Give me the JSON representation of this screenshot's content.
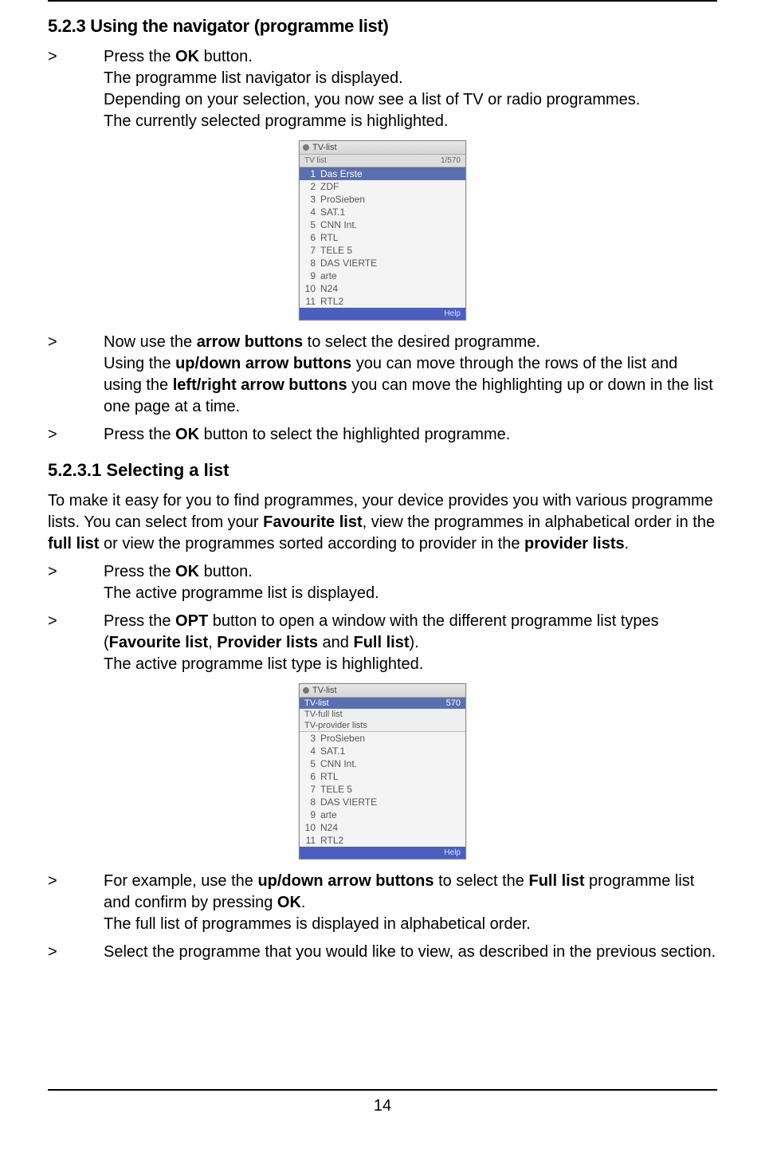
{
  "page_number": "14",
  "section_523": {
    "heading": "5.2.3 Using the navigator (programme list)",
    "step1": {
      "prefix": "Press the ",
      "bold1": "OK",
      "suffix": " button."
    },
    "para1": "The programme list navigator is displayed.",
    "para2": "Depending on your selection, you now see a list of TV or radio programmes.",
    "para3": "The currently selected programme is highlighted.",
    "step2": {
      "prefix": "Now use the ",
      "bold1": "arrow buttons",
      "mid1": " to select the desired programme."
    },
    "para4": {
      "p1": "Using the ",
      "b1": "up/down arrow buttons",
      "p2": " you can move through the rows of the list and using the ",
      "b2": "left/right arrow buttons",
      "p3": " you can move the highlighting up or down in the list one page at a time."
    },
    "step3": {
      "prefix": "Press the ",
      "bold1": "OK",
      "suffix": " button to select the highlighted programme."
    }
  },
  "section_5231": {
    "heading": "5.2.3.1 Selecting a list",
    "para1": {
      "p1": "To make it easy for you to find programmes, your device provides you with various programme lists. You can select from your ",
      "b1": "Favourite list",
      "p2": ", view the programmes in alphabetical order in the ",
      "b2": "full list",
      "p3": " or view the programmes sorted according to provider in the ",
      "b3": "provider lists",
      "p4": "."
    },
    "step1": {
      "prefix": "Press the ",
      "bold1": "OK",
      "suffix": " button."
    },
    "step1_text": "The active programme list is displayed.",
    "step2": {
      "prefix": "Press the ",
      "bold1": "OPT",
      "mid": " button to open a window with the different programme list types ("
    },
    "step2_list": {
      "b1": "Favourite list",
      "sep1": ", ",
      "b2": "Provider lists",
      "sep2": " and ",
      "b3": "Full list",
      "end": ")."
    },
    "step2_text": "The active programme list type is highlighted.",
    "step3": {
      "p1": "For example, use the ",
      "b1": "up/down arrow buttons",
      "p2": " to select the ",
      "b2": "Full list",
      "p3": " programme list and confirm by pressing ",
      "b3": "OK",
      "p4": "."
    },
    "step3_text": "The full list of programmes is displayed in alphabetical order.",
    "step4": "Select the programme that you would like to view, as described in the previous section."
  },
  "screenshot1": {
    "title": "TV-list",
    "sub_left": "TV list",
    "sub_right": "1/570",
    "rows": [
      {
        "num": "1",
        "name": "Das Erste",
        "sel": true
      },
      {
        "num": "2",
        "name": "ZDF",
        "sel": false
      },
      {
        "num": "3",
        "name": "ProSieben",
        "sel": false
      },
      {
        "num": "4",
        "name": "SAT.1",
        "sel": false
      },
      {
        "num": "5",
        "name": "CNN Int.",
        "sel": false
      },
      {
        "num": "6",
        "name": "RTL",
        "sel": false
      },
      {
        "num": "7",
        "name": "TELE 5",
        "sel": false
      },
      {
        "num": "8",
        "name": "DAS VIERTE",
        "sel": false
      },
      {
        "num": "9",
        "name": "arte",
        "sel": false
      },
      {
        "num": "10",
        "name": "N24",
        "sel": false
      },
      {
        "num": "11",
        "name": "RTL2",
        "sel": false
      }
    ],
    "footer": "Help"
  },
  "screenshot2": {
    "title": "TV-list",
    "menu": [
      {
        "label": "TV-list",
        "sel": true
      },
      {
        "label": "TV-full list",
        "sel": false
      },
      {
        "label": "TV-provider lists",
        "sel": false
      }
    ],
    "sub_right": "570",
    "rows": [
      {
        "num": "3",
        "name": "ProSieben",
        "sel": false
      },
      {
        "num": "4",
        "name": "SAT.1",
        "sel": false
      },
      {
        "num": "5",
        "name": "CNN Int.",
        "sel": false
      },
      {
        "num": "6",
        "name": "RTL",
        "sel": false
      },
      {
        "num": "7",
        "name": "TELE 5",
        "sel": false
      },
      {
        "num": "8",
        "name": "DAS VIERTE",
        "sel": false
      },
      {
        "num": "9",
        "name": "arte",
        "sel": false
      },
      {
        "num": "10",
        "name": "N24",
        "sel": false
      },
      {
        "num": "11",
        "name": "RTL2",
        "sel": false
      }
    ],
    "footer": "Help"
  }
}
